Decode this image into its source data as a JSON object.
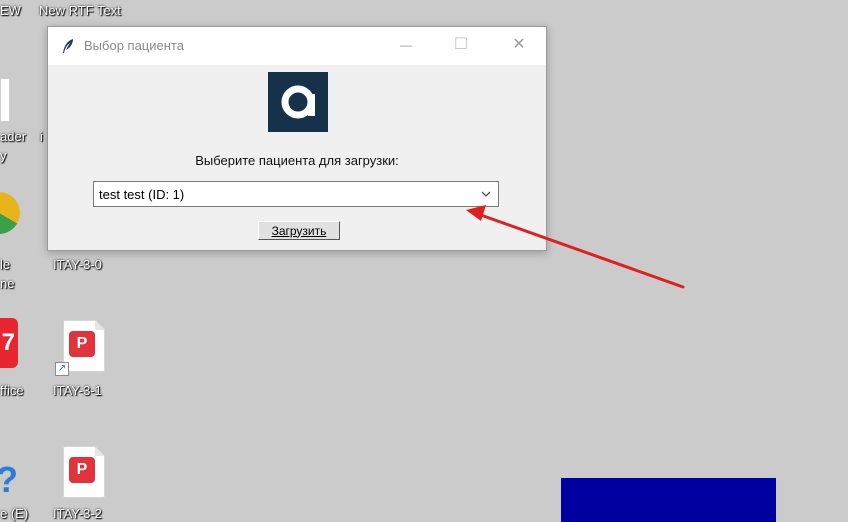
{
  "desktop": {
    "top_labels": [
      "EW",
      "New RTF Text"
    ],
    "left_labels": [
      "ader",
      "y",
      "le",
      "ne",
      "ffice",
      "e (E)"
    ],
    "files": [
      {
        "label": "ITAY-3-0"
      },
      {
        "label": "ITAY-3-1"
      },
      {
        "label": "ITAY-3-2"
      }
    ],
    "pdf_glyph": "P",
    "partial_label": "i"
  },
  "dialog": {
    "title": "Выбор пациента",
    "title_icon": "feather-icon",
    "minimize_glyph": "—",
    "maximize_glyph": "☐",
    "close_glyph": "✕",
    "logo_letter": "a",
    "logo_color": "#16314a",
    "prompt": "Выберите пациента для загрузки:",
    "combo_value": "test test (ID: 1)",
    "button_label": "Загрузить"
  },
  "colors": {
    "desktop_bg": "#cbcbcb",
    "arrow": "#e0201e",
    "blue_block": "#0000a0"
  }
}
